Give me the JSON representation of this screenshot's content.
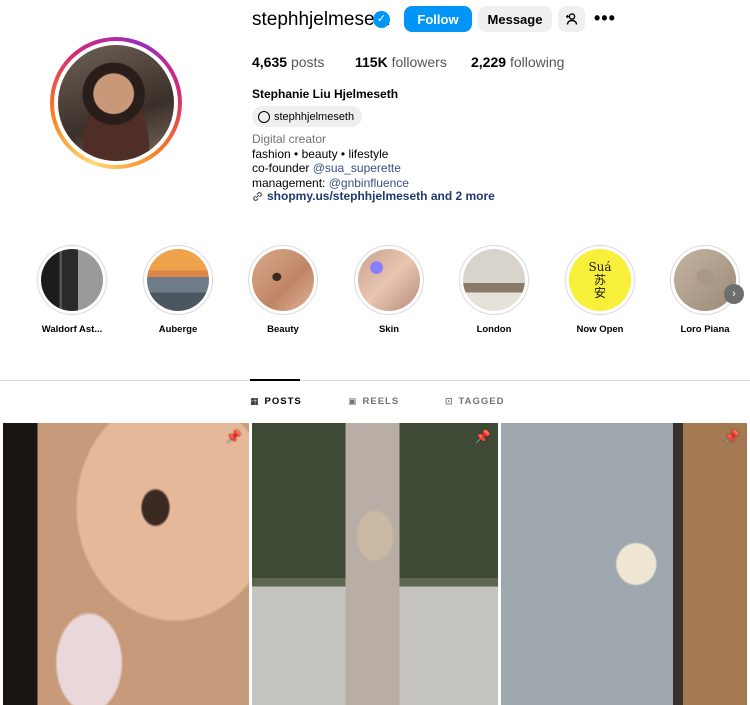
{
  "profile": {
    "username": "stephhjelmeseth",
    "follow_label": "Follow",
    "message_label": "Message",
    "posts_count": "4,635",
    "posts_label": "posts",
    "followers_count": "115K",
    "followers_label": "followers",
    "following_count": "2,229",
    "following_label": "following",
    "full_name": "Stephanie Liu Hjelmeseth",
    "threads_handle": "stephhjelmeseth",
    "category": "Digital creator",
    "bio_line1": "fashion • beauty • lifestyle",
    "bio_line2_prefix": "co-founder ",
    "bio_line2_mention": "@sua_superette",
    "bio_line3_prefix": "management: ",
    "bio_line3_mention": "@gnbinfluence",
    "link_text": "shopmy.us/stephhjelmeseth and 2 more"
  },
  "highlights": [
    {
      "label": "Waldorf Ast..."
    },
    {
      "label": "Auberge"
    },
    {
      "label": "Beauty"
    },
    {
      "label": "Skin"
    },
    {
      "label": "London"
    },
    {
      "label": "Now Open",
      "sticker_line1": "Suá",
      "sticker_line2": "苏",
      "sticker_line3": "安"
    },
    {
      "label": "Loro Piana"
    }
  ],
  "tabs": [
    {
      "label": "POSTS"
    },
    {
      "label": "REELS"
    },
    {
      "label": "TAGGED"
    }
  ],
  "colors": {
    "accent": "#0095f6",
    "link": "#385185",
    "highlight_yellow": "#f7ef3a"
  },
  "icons": {
    "verified": "verified-badge-icon",
    "add_user": "add-person-icon",
    "more": "more-horizontal-icon",
    "threads": "threads-icon",
    "link": "link-icon",
    "pin": "pin-icon",
    "next": "chevron-right-icon"
  }
}
